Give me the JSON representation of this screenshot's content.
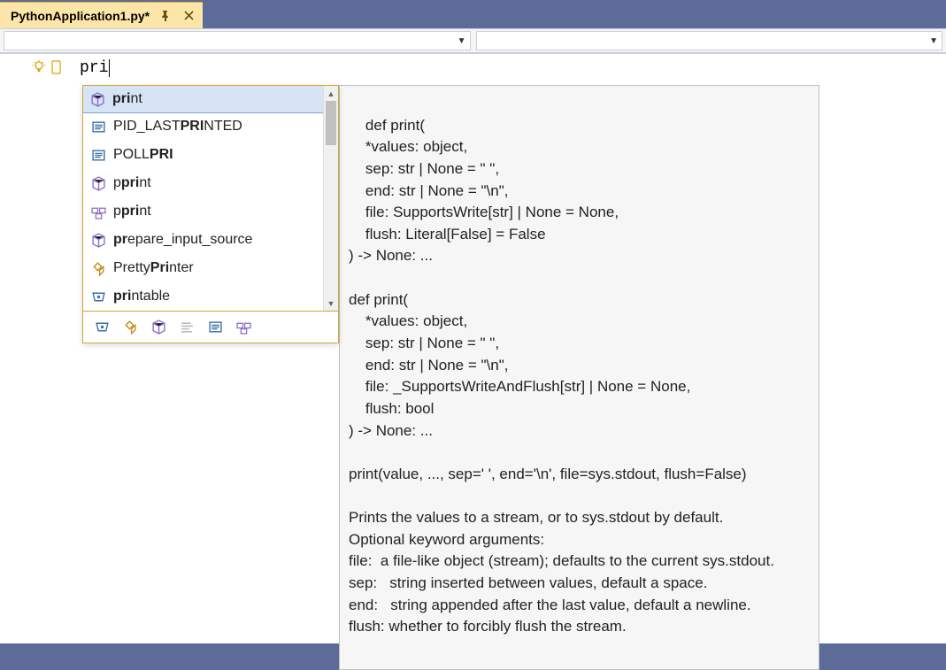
{
  "tab": {
    "title": "PythonApplication1.py*"
  },
  "nav": {
    "left_value": "",
    "right_value": ""
  },
  "editor": {
    "typed_text": "pri"
  },
  "intellisense": {
    "items": [
      {
        "icon": "cube",
        "pre": "",
        "match": "pri",
        "post": "nt",
        "selected": true
      },
      {
        "icon": "constant",
        "pre": "PID_LAST",
        "match": "PRI",
        "post": "NTED",
        "selected": false
      },
      {
        "icon": "constant",
        "pre": "POLL",
        "match": "PRI",
        "post": "",
        "selected": false
      },
      {
        "icon": "cube",
        "pre": "p",
        "match": "pri",
        "post": "nt",
        "selected": false
      },
      {
        "icon": "module",
        "pre": "p",
        "match": "pri",
        "post": "nt",
        "selected": false
      },
      {
        "icon": "cube",
        "pre": "",
        "match": "pr",
        "post": "epare_input_source",
        "selected": false
      },
      {
        "icon": "class",
        "pre": "Pretty",
        "match": "Pri",
        "post": "nter",
        "selected": false
      },
      {
        "icon": "variable",
        "pre": "",
        "match": "pri",
        "post": "ntable",
        "selected": false
      }
    ],
    "filter_icons": [
      "variable",
      "class",
      "cube",
      "snippet",
      "constant",
      "module"
    ]
  },
  "tooltip": {
    "text": "def print(\n    *values: object,\n    sep: str | None = \" \",\n    end: str | None = \"\\n\",\n    file: SupportsWrite[str] | None = None,\n    flush: Literal[False] = False\n) -> None: ...\n\ndef print(\n    *values: object,\n    sep: str | None = \" \",\n    end: str | None = \"\\n\",\n    file: _SupportsWriteAndFlush[str] | None = None,\n    flush: bool\n) -> None: ...\n\nprint(value, ..., sep=' ', end='\\n', file=sys.stdout, flush=False)\n\nPrints the values to a stream, or to sys.stdout by default.\nOptional keyword arguments:\nfile:  a file-like object (stream); defaults to the current sys.stdout.\nsep:   string inserted between values, default a space.\nend:   string appended after the last value, default a newline.\nflush: whether to forcibly flush the stream."
  },
  "colors": {
    "accent": "#5d6b99",
    "tab_bg": "#fce5a8",
    "intellisense_border": "#ccaa33",
    "selection_bg": "#d6e4f5"
  }
}
